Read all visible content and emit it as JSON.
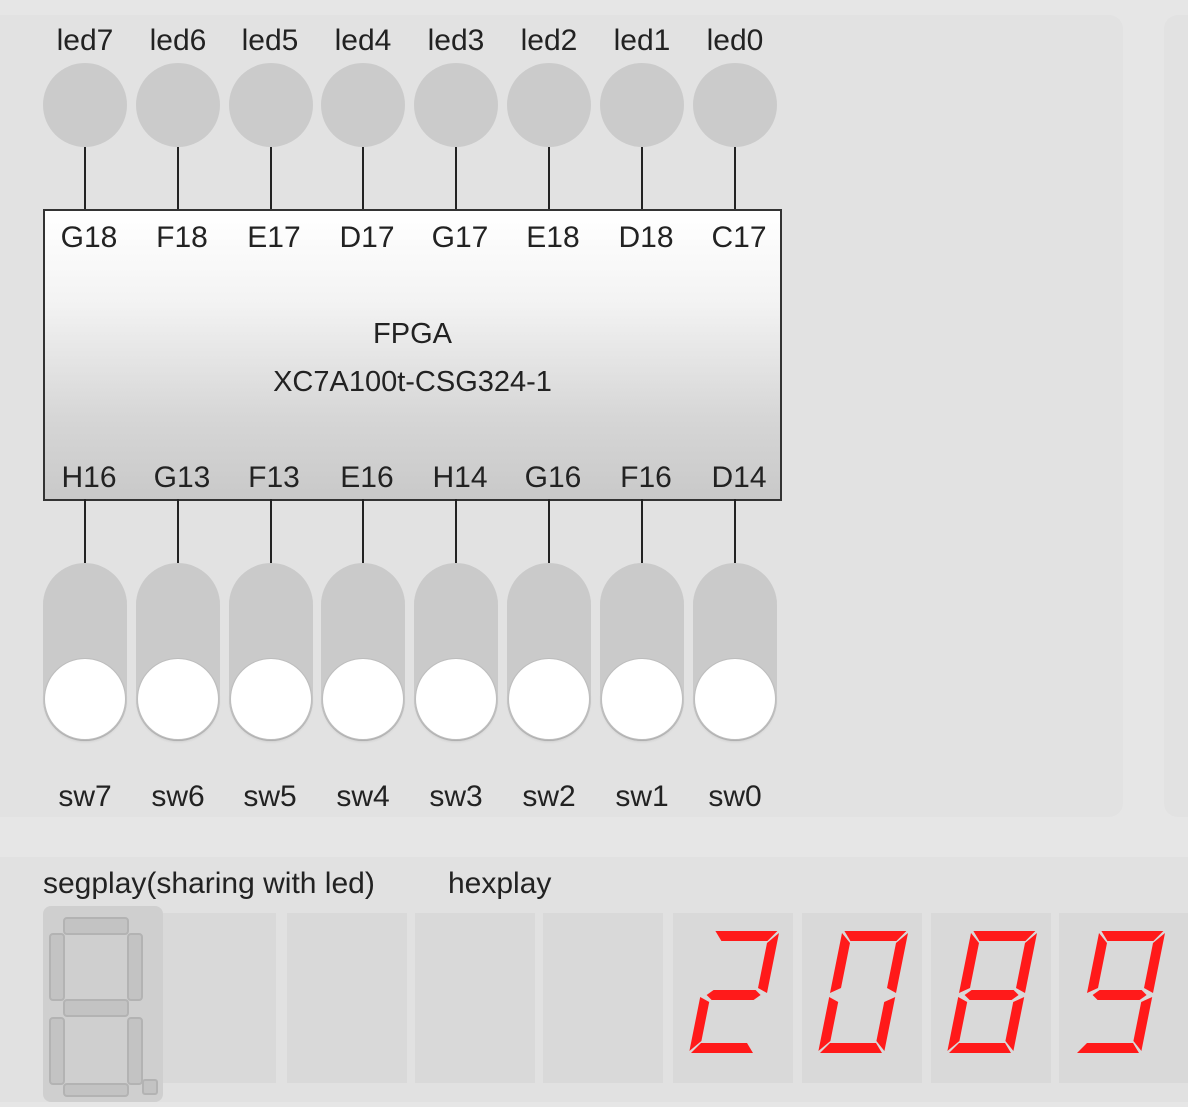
{
  "leds": [
    {
      "label": "led7",
      "pin": "G18"
    },
    {
      "label": "led6",
      "pin": "F18"
    },
    {
      "label": "led5",
      "pin": "E17"
    },
    {
      "label": "led4",
      "pin": "D17"
    },
    {
      "label": "led3",
      "pin": "G17"
    },
    {
      "label": "led2",
      "pin": "E18"
    },
    {
      "label": "led1",
      "pin": "D18"
    },
    {
      "label": "led0",
      "pin": "C17"
    }
  ],
  "fpga": {
    "name": "FPGA",
    "part": "XC7A100t-CSG324-1"
  },
  "switches": [
    {
      "label": "sw7",
      "pin": "H16",
      "state": "off"
    },
    {
      "label": "sw6",
      "pin": "G13",
      "state": "off"
    },
    {
      "label": "sw5",
      "pin": "F13",
      "state": "off"
    },
    {
      "label": "sw4",
      "pin": "E16",
      "state": "off"
    },
    {
      "label": "sw3",
      "pin": "H14",
      "state": "off"
    },
    {
      "label": "sw2",
      "pin": "G16",
      "state": "off"
    },
    {
      "label": "sw1",
      "pin": "F16",
      "state": "off"
    },
    {
      "label": "sw0",
      "pin": "D14",
      "state": "off"
    }
  ],
  "segplay": {
    "label": "segplay(sharing with led)"
  },
  "hexplay": {
    "label": "hexplay",
    "digits": [
      "2",
      "0",
      "8",
      "9"
    ]
  },
  "colors": {
    "segment_on": "#ff1a1a",
    "segment_off": "#c3c3c3",
    "led_off": "#cbcbcb"
  }
}
